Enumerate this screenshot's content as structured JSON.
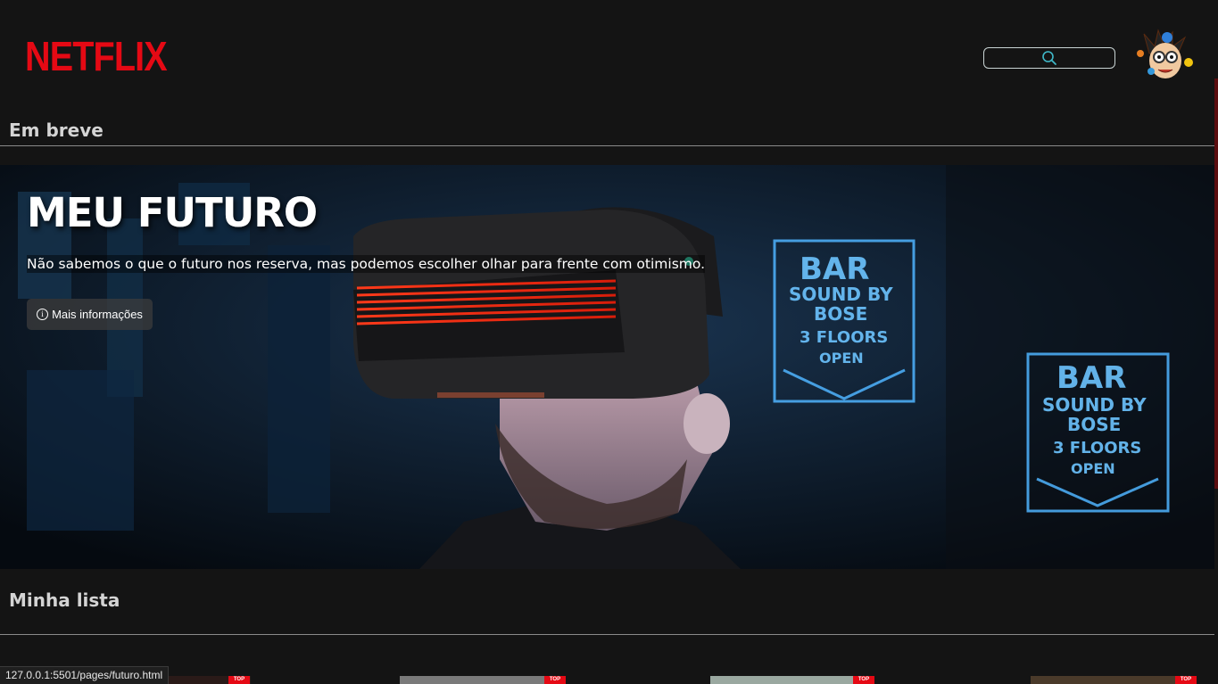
{
  "header": {
    "logo_text": "NETFLIX",
    "search": {
      "icon": "search-icon"
    },
    "avatar": {
      "icon": "developer-avatar-icon"
    }
  },
  "sections": {
    "coming_soon_title": "Em breve",
    "my_list_title": "Minha lista"
  },
  "hero": {
    "title": "MEU FUTURO",
    "description": "Não sabemos o que o futuro nos reserva, mas podemos escolher olhar para frente com otimismo.",
    "info_button_label": "Mais informações",
    "info_icon": "info-icon",
    "neon_sign_text": [
      "BAR",
      "SOUND BY",
      "BOSE",
      "3 FLOORS",
      "OPEN"
    ]
  },
  "my_list": {
    "badge_label": "TOP"
  },
  "status_bar": {
    "url": "127.0.0.1:5501/pages/futuro.html"
  },
  "colors": {
    "background": "#141414",
    "brand_red": "#e50914",
    "neon_blue": "#4fb4ff"
  }
}
